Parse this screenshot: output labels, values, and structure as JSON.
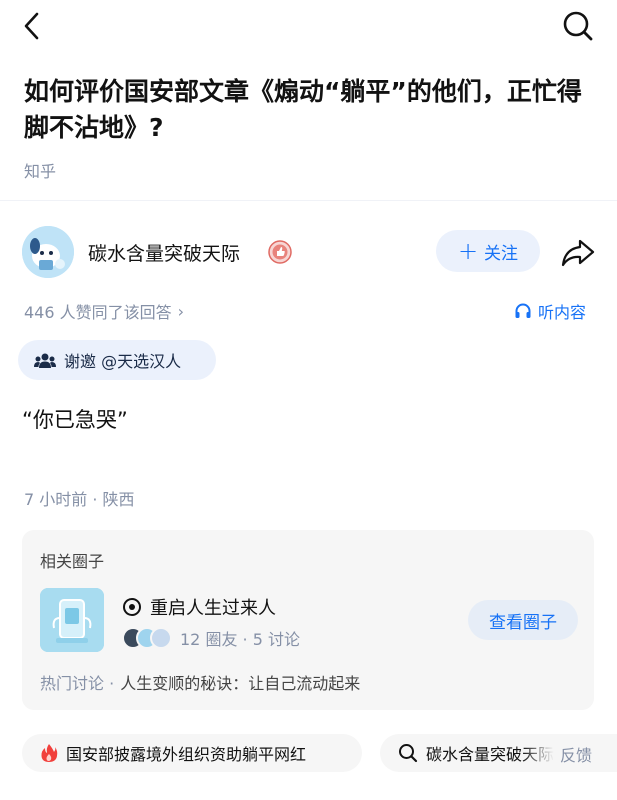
{
  "header": {
    "back_icon": "chevron-left-icon",
    "search_icon": "search-icon"
  },
  "question": {
    "title": "如何评价国安部文章《煽动“躺平”的他们，正忙得脚不沾地》?",
    "source": "知乎"
  },
  "author": {
    "name": "碳水含量突破天际",
    "badge_icon": "thumbs-up-badge-icon",
    "follow_label": "关注",
    "share_icon": "share-arrow-icon"
  },
  "answer": {
    "votes_text": "446 人赞同了该回答",
    "votes_chevron": "›",
    "listen_label": "听内容",
    "invite_label": "谢邀 @天选汉人",
    "content": "“你已急哭”",
    "meta": "7 小时前 · 陕西"
  },
  "related_circle": {
    "heading": "相关圈子",
    "name": "重启人生过来人",
    "stats": "12 圈友 · 5 讨论",
    "view_button": "查看圈子",
    "hot_label": "热门讨论 ·",
    "hot_text": "人生变顺的秘诀：让自己流动起来"
  },
  "bottom": {
    "chip_hot": "国安部披露境外组织资助躺平网红",
    "chip_search": "碳水含量突破天际",
    "feedback": "反馈"
  },
  "colors": {
    "accent": "#1772f6",
    "muted": "#8590a6",
    "chip_bg": "#ebf1fc",
    "card_bg": "#f6f6f6",
    "fire": "#f1403c"
  }
}
